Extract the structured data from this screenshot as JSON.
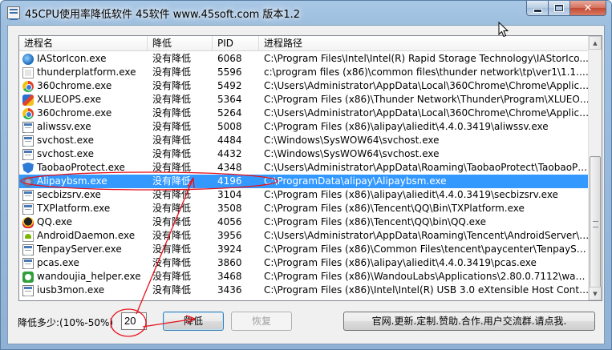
{
  "window": {
    "title": "45CPU使用率降低软件 45软件 www.45soft.com 版本1.2",
    "minimize_icon": "minimize-icon",
    "maximize_icon": "maximize-icon",
    "close_icon": "close-icon",
    "close_glyph": "✕"
  },
  "list": {
    "columns": [
      "进程名",
      "降低",
      "PID",
      "进程路径"
    ],
    "rows": [
      {
        "icon": "irst",
        "name": "IAStorIcon.exe",
        "reduce": "没有降低",
        "pid": "6068",
        "path": "C:\\Program Files\\Intel\\Intel(R) Rapid Storage Technology\\IAStorIco..."
      },
      {
        "icon": "thunder",
        "name": "thunderplatform.exe",
        "reduce": "没有降低",
        "pid": "5596",
        "path": "c:\\program files (x86)\\common files\\thunder network\\tp\\ver1\\1.1.2..."
      },
      {
        "icon": "chrome360",
        "name": "360chrome.exe",
        "reduce": "没有降低",
        "pid": "5492",
        "path": "C:\\Users\\Administrator\\AppData\\Local\\360Chrome\\Chrome\\Applicati..."
      },
      {
        "icon": "xlue",
        "name": "XLUEOPS.exe",
        "reduce": "没有降低",
        "pid": "5364",
        "path": "C:\\Program Files (x86)\\Thunder Network\\Thunder\\Program\\XLUEOPS..."
      },
      {
        "icon": "chrome360",
        "name": "360chrome.exe",
        "reduce": "没有降低",
        "pid": "5264",
        "path": "C:\\Users\\Administrator\\AppData\\Local\\360Chrome\\Chrome\\Applicati..."
      },
      {
        "icon": "generic",
        "name": "aliwssv.exe",
        "reduce": "没有降低",
        "pid": "5008",
        "path": "C:\\Program Files (x86)\\alipay\\aliedit\\4.4.0.3419\\aliwssv.exe"
      },
      {
        "icon": "generic",
        "name": "svchost.exe",
        "reduce": "没有降低",
        "pid": "4484",
        "path": "C:\\Windows\\SysWOW64\\svchost.exe"
      },
      {
        "icon": "generic",
        "name": "svchost.exe",
        "reduce": "没有降低",
        "pid": "4432",
        "path": "C:\\Windows\\SysWOW64\\svchost.exe"
      },
      {
        "icon": "taobao",
        "name": "TaobaoProtect.exe",
        "reduce": "没有降低",
        "pid": "4348",
        "path": "C:\\Users\\Administrator\\AppData\\Roaming\\TaobaoProtect\\TaobaoPro..."
      },
      {
        "icon": "alipay",
        "name": "Alipaybsm.exe",
        "reduce": "没有降低",
        "pid": "4196",
        "path": "C:\\ProgramData\\alipay\\Alipaybsm.exe",
        "selected": true
      },
      {
        "icon": "generic",
        "name": "secbizsrv.exe",
        "reduce": "没有降低",
        "pid": "3104",
        "path": "C:\\Program Files (x86)\\alipay\\aliedit\\4.4.0.3419\\secbizsrv.exe"
      },
      {
        "icon": "generic",
        "name": "TXPlatform.exe",
        "reduce": "没有降低",
        "pid": "3508",
        "path": "C:\\Program Files (x86)\\Tencent\\QQ\\Bin\\TXPlatform.exe"
      },
      {
        "icon": "qq",
        "name": "QQ.exe",
        "reduce": "没有降低",
        "pid": "4056",
        "path": "C:\\Program Files (x86)\\Tencent\\QQ\\bin\\QQ.exe"
      },
      {
        "icon": "android",
        "name": "AndroidDaemon.exe",
        "reduce": "没有降低",
        "pid": "3956",
        "path": "C:\\Users\\Administrator\\AppData\\Roaming\\Tencent\\AndroidServer\\1...."
      },
      {
        "icon": "generic",
        "name": "TenpayServer.exe",
        "reduce": "没有降低",
        "pid": "3924",
        "path": "C:\\Program Files (x86)\\Common Files\\tencent\\paycenter\\TenpayServ..."
      },
      {
        "icon": "generic",
        "name": "pcas.exe",
        "reduce": "没有降低",
        "pid": "3860",
        "path": "C:\\Program Files (x86)\\alipay\\aliedit\\4.4.0.3419\\pcas.exe"
      },
      {
        "icon": "wandou",
        "name": "wandoujia_helper.exe",
        "reduce": "没有降低",
        "pid": "3468",
        "path": "C:\\Program Files (x86)\\WandouLabs\\Applications\\2.80.0.7112\\wandou..."
      },
      {
        "icon": "generic",
        "name": "iusb3mon.exe",
        "reduce": "没有降低",
        "pid": "3436",
        "path": "C:\\Program Files (x86)\\Intel\\Intel(R) USB 3.0 eXtensible Host Contro..."
      }
    ],
    "scroll_up_glyph": "▲",
    "scroll_down_glyph": "▼"
  },
  "controls": {
    "reduce_amount_label": "降低多少:(10%-50%)",
    "reduce_amount_value": "20",
    "reduce_button": "降低",
    "restore_button": "恢复",
    "website_button": "官网.更新.定制.赞助.合作.用户交流群.请点我."
  },
  "colors": {
    "selection": "#3399ff",
    "annotation": "#e8101a"
  }
}
